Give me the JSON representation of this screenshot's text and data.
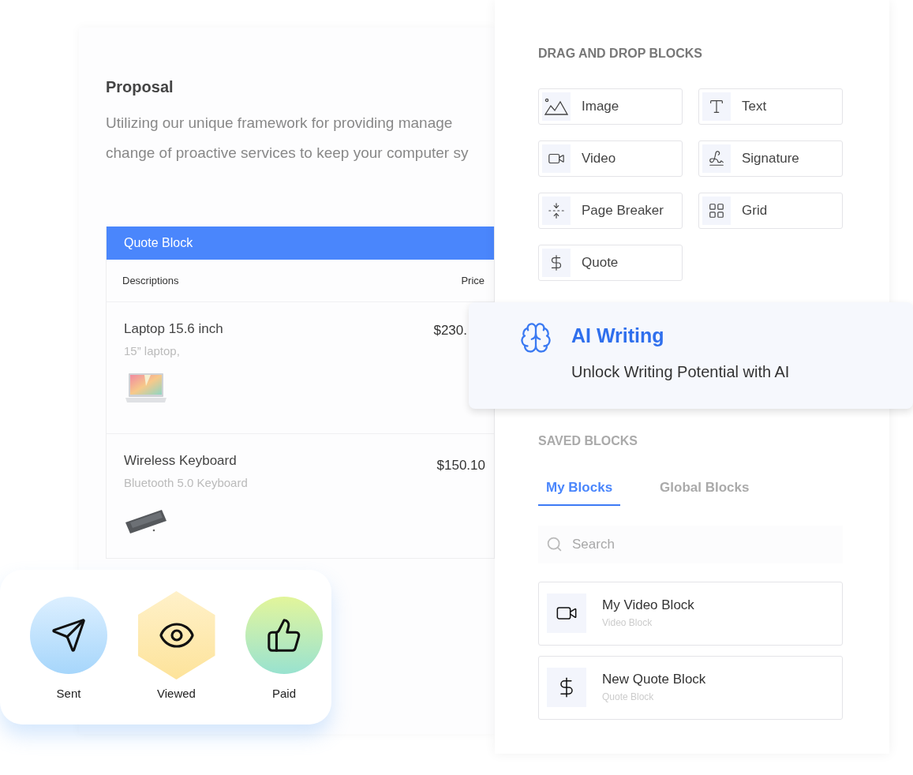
{
  "document": {
    "title": "Proposal",
    "body_lines": [
      "Utilizing our unique framework for providing manage",
      "change of proactive services to keep your computer sy"
    ],
    "quote_block": {
      "title": "Quote Block",
      "columns": [
        "Descriptions",
        "Price"
      ],
      "rows": [
        {
          "name": "Laptop 15.6 inch",
          "description": "15” laptop,",
          "price": "$230."
        },
        {
          "name": "Wireless Keyboard",
          "description": "Bluetooth 5.0 Keyboard",
          "price": "$150.10"
        }
      ]
    }
  },
  "status_card": {
    "steps": [
      {
        "label": "Sent",
        "kind": "sent"
      },
      {
        "label": "Viewed",
        "kind": "viewed"
      },
      {
        "label": "Paid",
        "kind": "paid"
      }
    ]
  },
  "panel": {
    "drag_heading": "DRAG AND DROP BLOCKS",
    "blocks": [
      {
        "label": "Image"
      },
      {
        "label": "Text",
        "kind": "text"
      },
      {
        "label": "Video",
        "kind": "video"
      },
      {
        "label": "Signature",
        "kind": "signature"
      },
      {
        "label": "Page Breaker",
        "kind": "page_breaker"
      },
      {
        "label": "Grid",
        "kind": "grid"
      },
      {
        "label": "Quote",
        "kind": "quote"
      }
    ],
    "saved_heading": "SAVED BLOCKS",
    "tabs": [
      {
        "label": "My Blocks",
        "selected": true
      },
      {
        "label": "Global Blocks",
        "selected": false
      }
    ],
    "search": {
      "placeholder": "Search"
    },
    "saved_blocks": [
      {
        "title": "My Video Block",
        "subtitle": "Video Block",
        "kind": "video"
      },
      {
        "title": "New Quote Block",
        "subtitle": "Quote Block",
        "kind": "quote"
      }
    ]
  },
  "ai_card": {
    "title": "AI Writing",
    "subtitle": "Unlock Writing Potential with AI"
  }
}
